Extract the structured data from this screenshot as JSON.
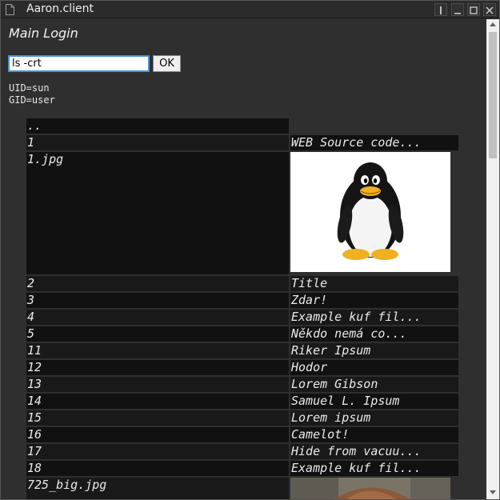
{
  "window": {
    "title": "Aaron.client",
    "icon": "document-icon",
    "controls": [
      "pin-icon",
      "minimize-icon",
      "maximize-icon",
      "close-icon"
    ]
  },
  "header": {
    "heading": "Main Login"
  },
  "command": {
    "value": "ls -crt",
    "ok_label": "OK"
  },
  "identity": {
    "uid": "UID=sun",
    "gid": "GID=user"
  },
  "listing": {
    "parent": "..",
    "rows": [
      {
        "name": "1",
        "desc": "WEB Source code..."
      },
      {
        "name": "1.jpg",
        "image": "penguin-image"
      },
      {
        "name": "2",
        "desc": "Title"
      },
      {
        "name": "3",
        "desc": "Zdar!"
      },
      {
        "name": "4",
        "desc": "Example kuf fil..."
      },
      {
        "name": "5",
        "desc": "Někdo nemá co..."
      },
      {
        "name": "11",
        "desc": "Riker Ipsum"
      },
      {
        "name": "12",
        "desc": "Hodor"
      },
      {
        "name": "13",
        "desc": "Lorem Gibson"
      },
      {
        "name": "14",
        "desc": "Samuel L. Ipsum"
      },
      {
        "name": "15",
        "desc": "Lorem ipsum"
      },
      {
        "name": "16",
        "desc": "Camelot!"
      },
      {
        "name": "17",
        "desc": "Hide from vacuu..."
      },
      {
        "name": "18",
        "desc": "Example kuf fil..."
      },
      {
        "name": "725_big.jpg",
        "image": "photo-image"
      }
    ]
  },
  "colors": {
    "accent": "#4a90d9",
    "panel": "#2f2f2f",
    "cell_dark": "#111111",
    "cell_mid": "#191919"
  }
}
